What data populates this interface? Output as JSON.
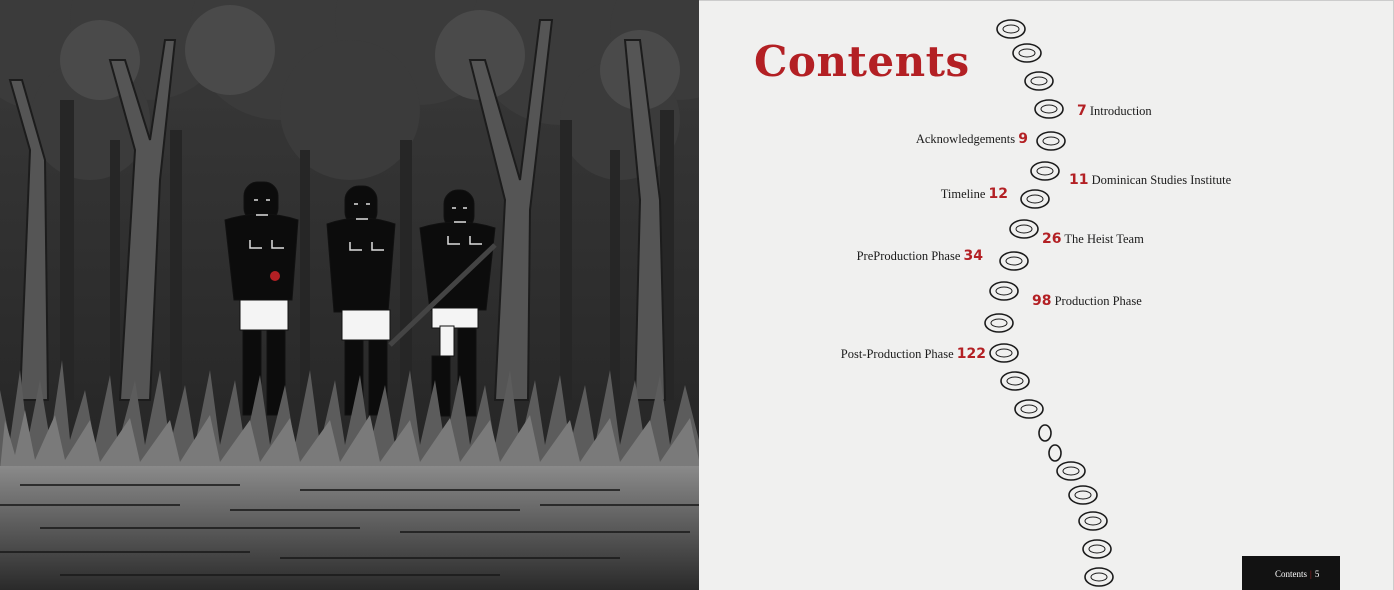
{
  "illustration": {
    "description_icon": "forest-figures-illustration",
    "accent_color": "#b32024"
  },
  "contents": {
    "title": "Contents",
    "entries": [
      {
        "page": "7",
        "label": "Introduction"
      },
      {
        "page": "9",
        "label": "Acknowledgements"
      },
      {
        "page": "11",
        "label": "Dominican Studies Institute"
      },
      {
        "page": "12",
        "label": "Timeline"
      },
      {
        "page": "26",
        "label": "The Heist Team"
      },
      {
        "page": "34",
        "label": "PreProduction Phase"
      },
      {
        "page": "98",
        "label": "Production Phase"
      },
      {
        "page": "122",
        "label": "Post-Production Phase"
      }
    ]
  },
  "footer": {
    "section": "Contents",
    "separator": "|",
    "page_number": "5"
  },
  "colors": {
    "accent": "#b32024",
    "paper": "#f0f0ef",
    "ink": "#1b1b1b"
  }
}
